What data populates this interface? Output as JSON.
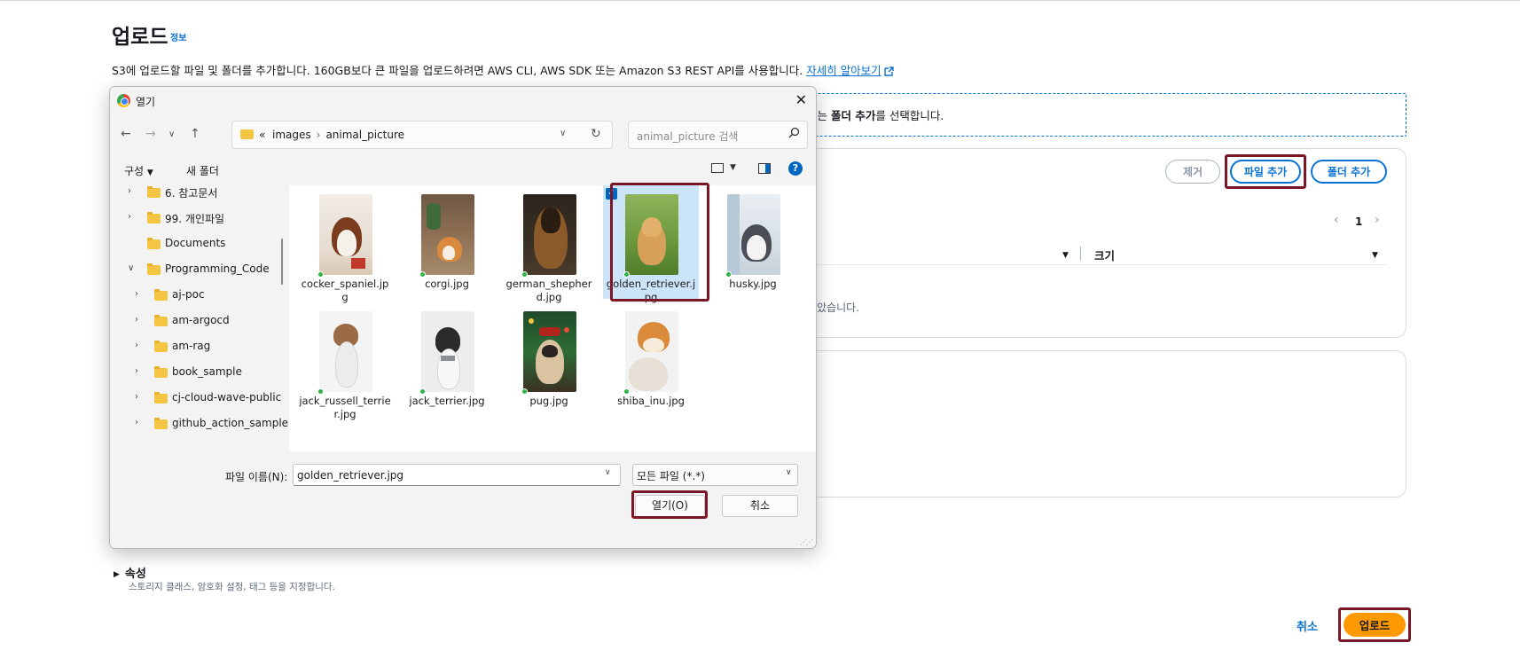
{
  "page": {
    "title": "업로드",
    "info_link": "정보",
    "description": "S3에 업로드할 파일 및 폴더를 추가합니다. 160GB보다 큰 파일을 업로드하려면 AWS CLI, AWS SDK 또는 Amazon S3 REST API를 사용합니다.",
    "learn_more": "자세히 알아보기",
    "dropzone_prefix": "또는 ",
    "dropzone_bold": "폴더 추가",
    "dropzone_suffix": "를 선택합니다.",
    "buttons": {
      "remove": "제거",
      "add_files": "파일 추가",
      "add_folder": "폴더 추가"
    },
    "pagination": {
      "current_page": "1"
    },
    "table": {
      "size_header": "크기",
      "empty_text": "않았습니다."
    },
    "properties": {
      "title": "속성",
      "description": "스토리지 클래스, 암호화 설정, 태그 등을 지정합니다."
    },
    "footer": {
      "cancel": "취소",
      "upload": "업로드"
    }
  },
  "dialog": {
    "title": "열기",
    "address": {
      "ellipsis": "«",
      "path": [
        "images",
        "animal_picture"
      ]
    },
    "search_placeholder": "animal_picture 검색",
    "toolbar": {
      "organize": "구성",
      "new_folder": "새 폴더",
      "help": "?"
    },
    "tree": [
      {
        "label": "6. 참고문서"
      },
      {
        "label": "99. 개인파일"
      },
      {
        "label": "Documents"
      },
      {
        "label": "Programming_Code"
      },
      {
        "label": "aj-poc"
      },
      {
        "label": "am-argocd"
      },
      {
        "label": "am-rag"
      },
      {
        "label": "book_sample"
      },
      {
        "label": "cj-cloud-wave-public"
      },
      {
        "label": "github_action_sample"
      }
    ],
    "files": [
      {
        "name": "cocker_spaniel.jpg",
        "selected": false
      },
      {
        "name": "corgi.jpg",
        "selected": false
      },
      {
        "name": "german_shepherd.jpg",
        "selected": false
      },
      {
        "name": "golden_retriever.jpg",
        "selected": true
      },
      {
        "name": "husky.jpg",
        "selected": false
      },
      {
        "name": "jack_russell_terrier.jpg",
        "selected": false
      },
      {
        "name": "jack_terrier.jpg",
        "selected": false
      },
      {
        "name": "pug.jpg",
        "selected": false
      },
      {
        "name": "shiba_inu.jpg",
        "selected": false
      }
    ],
    "filename_label": "파일 이름(N):",
    "filename_value": "golden_retriever.jpg",
    "filetype": "모든 파일 (*.*)",
    "open_button": "열기(O)",
    "cancel_button": "취소"
  },
  "colors": {
    "aws_link": "#0972d3",
    "upload_button": "#ff9900",
    "highlight_box": "#7b1626",
    "selection": "#cce4f7"
  }
}
